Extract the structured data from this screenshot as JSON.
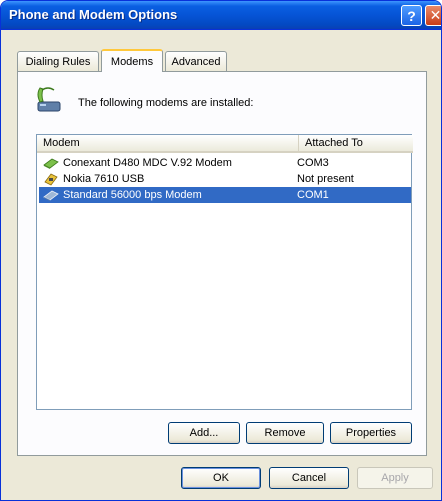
{
  "window": {
    "title": "Phone and Modem Options"
  },
  "titlebar": {
    "help_label": "?",
    "close_label": "✕"
  },
  "tabs": [
    {
      "label": "Dialing Rules"
    },
    {
      "label": "Modems"
    },
    {
      "label": "Advanced"
    }
  ],
  "intro": {
    "text": "The following modems are installed:"
  },
  "table": {
    "headers": {
      "modem": "Modem",
      "attached_to": "Attached To"
    },
    "rows": [
      {
        "name": "Conexant D480 MDC V.92 Modem",
        "port": "COM3",
        "icon": "modem-icon",
        "selected": false
      },
      {
        "name": "Nokia 7610 USB",
        "port": "Not present",
        "icon": "phone-icon",
        "selected": false
      },
      {
        "name": "Standard 56000 bps Modem",
        "port": "COM1",
        "icon": "modem-icon",
        "selected": true
      }
    ]
  },
  "buttons": {
    "add": "Add...",
    "remove": "Remove",
    "properties": "Properties",
    "ok": "OK",
    "cancel": "Cancel",
    "apply": "Apply"
  },
  "colors": {
    "titlebar": "#0654d6",
    "selection": "#316ac5",
    "window_bg": "#ece9d8",
    "tab_highlight": "#ffc83c"
  }
}
